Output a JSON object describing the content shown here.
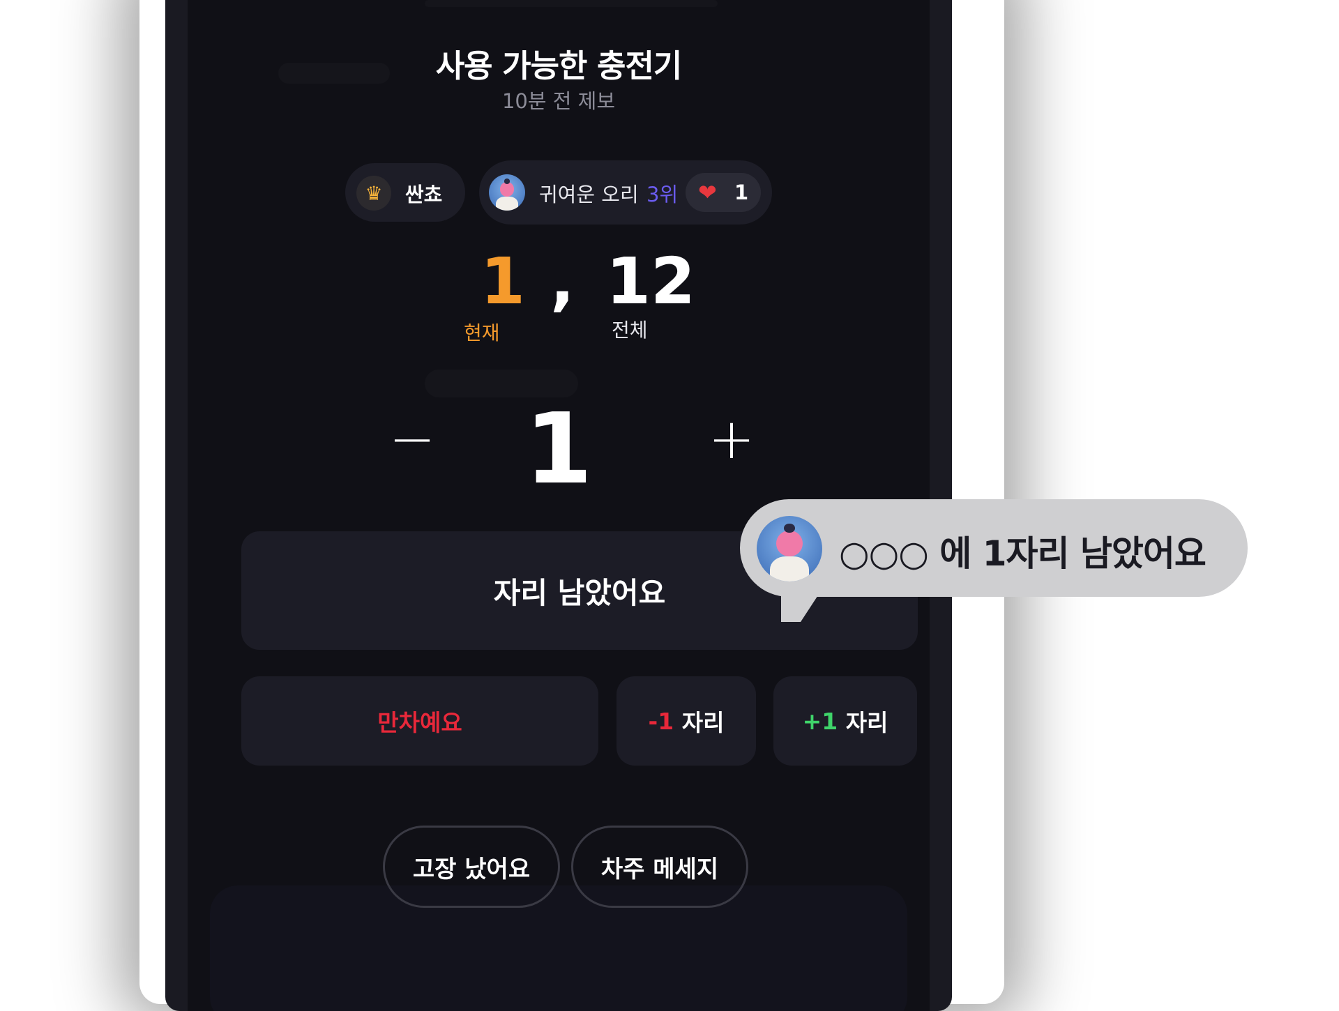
{
  "header": {
    "title": "사용 가능한 충전기",
    "subtitle": "10분 전 제보"
  },
  "reporter": {
    "king_icon": "crown-icon",
    "king_label": "싼쵸",
    "user_name": "귀여운 오리",
    "user_rank": "3위",
    "heart_icon": "heart-icon",
    "heart_count": "1"
  },
  "availability": {
    "current": "1",
    "separator": ",",
    "total": "12",
    "current_label": "현재",
    "total_label": "전체"
  },
  "stepper": {
    "minus": "−",
    "value": "1",
    "plus": "+"
  },
  "actions": {
    "main_label": "자리 남았어요",
    "full_label": "만차예요",
    "minus_prefix": "-1",
    "minus_suffix": " 자리",
    "plus_prefix": "+1",
    "plus_suffix": " 자리",
    "broken_label": "고장 났어요",
    "owner_label": "차주 메세지"
  },
  "bubble": {
    "text": "○○○ 에 1자리  남았어요"
  },
  "colors": {
    "accent_orange": "#f59a2c",
    "accent_purple": "#6b5cf0",
    "danger_red": "#e8283a",
    "success_green": "#3fd46a",
    "background": "#101016"
  }
}
